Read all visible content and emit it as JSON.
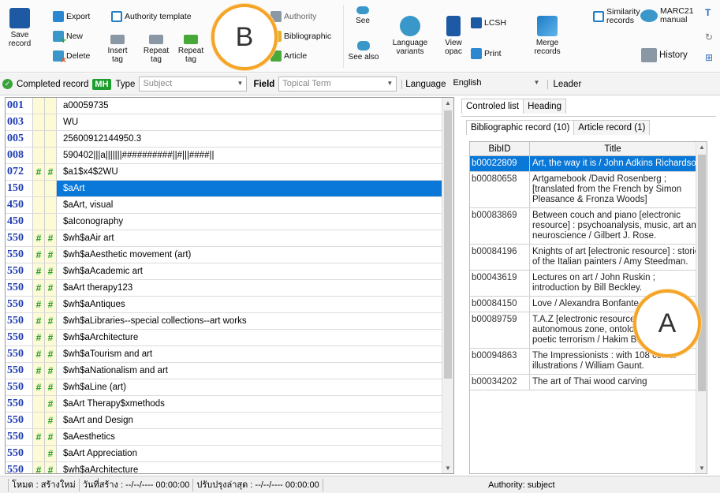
{
  "toolbar": {
    "save": {
      "line1": "Save",
      "line2": "record"
    },
    "export": "Export",
    "new": "New",
    "delete": "Delete",
    "authority_template": "Authority template",
    "insert_tag": {
      "line1": "Insert",
      "line2": "tag"
    },
    "repeat_tag1": {
      "line1": "Repeat",
      "line2": "tag"
    },
    "repeat_tag2": {
      "line1": "Repeat",
      "line2": "tag"
    },
    "authority": "Authority",
    "bibliographic": "Bibliographic",
    "article": "Article",
    "see": "See",
    "see_also": "See also",
    "language_variants": {
      "line1": "Language",
      "line2": "variants"
    },
    "view_opac": {
      "line1": "View",
      "line2": "opac"
    },
    "lcsh": "LCSH",
    "print": "Print",
    "merge_records": {
      "line1": "Merge",
      "line2": "records"
    },
    "similarity_records": {
      "line1": "Similarity",
      "line2": "records"
    },
    "marc21_manual": {
      "line1": "MARC21",
      "line2": "manual"
    },
    "history": "History"
  },
  "callouts": {
    "a": "A",
    "b": "B"
  },
  "status_bar": {
    "completed_record": "Completed record",
    "mh_badge": "MH",
    "type_label": "Type",
    "type_value": "Subject",
    "field_label": "Field",
    "field_value": "Topical Term",
    "language_label": "Language",
    "language_value": "English",
    "leader_label": "Leader"
  },
  "marc_rows": [
    {
      "tag": "001",
      "ind1": "",
      "ind2": "",
      "data": "a00059735"
    },
    {
      "tag": "003",
      "ind1": "",
      "ind2": "",
      "data": "WU"
    },
    {
      "tag": "005",
      "ind1": "",
      "ind2": "",
      "data": "25600912144950.3"
    },
    {
      "tag": "008",
      "ind1": "",
      "ind2": "",
      "data": "590402|||a|||||||##########||#|||####||"
    },
    {
      "tag": "072",
      "ind1": "#",
      "ind2": "#",
      "data": "$a1$x4$2WU"
    },
    {
      "tag": "150",
      "ind1": "",
      "ind2": "",
      "data": "$aArt",
      "selected": true
    },
    {
      "tag": "450",
      "ind1": "",
      "ind2": "",
      "data": "$aArt, visual"
    },
    {
      "tag": "450",
      "ind1": "",
      "ind2": "",
      "data": "$aIconography"
    },
    {
      "tag": "550",
      "ind1": "#",
      "ind2": "#",
      "data": "$wh$aAir art"
    },
    {
      "tag": "550",
      "ind1": "#",
      "ind2": "#",
      "data": "$wh$aAesthetic movement (art)"
    },
    {
      "tag": "550",
      "ind1": "#",
      "ind2": "#",
      "data": "$wh$aAcademic art"
    },
    {
      "tag": "550",
      "ind1": "#",
      "ind2": "#",
      "data": "$aArt therapy123"
    },
    {
      "tag": "550",
      "ind1": "#",
      "ind2": "#",
      "data": "$wh$aAntiques"
    },
    {
      "tag": "550",
      "ind1": "#",
      "ind2": "#",
      "data": "$wh$aLibraries--special collections--art works"
    },
    {
      "tag": "550",
      "ind1": "#",
      "ind2": "#",
      "data": "$wh$aArchitecture"
    },
    {
      "tag": "550",
      "ind1": "#",
      "ind2": "#",
      "data": "$wh$aTourism and art"
    },
    {
      "tag": "550",
      "ind1": "#",
      "ind2": "#",
      "data": "$wh$aNationalism and art"
    },
    {
      "tag": "550",
      "ind1": "#",
      "ind2": "#",
      "data": "$wh$aLine (art)"
    },
    {
      "tag": "550",
      "ind1": "",
      "ind2": "#",
      "data": "$aArt Therapy$xmethods"
    },
    {
      "tag": "550",
      "ind1": "",
      "ind2": "#",
      "data": "$aArt and Design"
    },
    {
      "tag": "550",
      "ind1": "#",
      "ind2": "#",
      "data": "$aAesthetics"
    },
    {
      "tag": "550",
      "ind1": "",
      "ind2": "#",
      "data": "$aArt Appreciation"
    },
    {
      "tag": "550",
      "ind1": "#",
      "ind2": "#",
      "data": "$wh$aArchitecture"
    }
  ],
  "right_panel": {
    "tab_controled_list": "Controled list",
    "tab_heading": "Heading",
    "subtab_bibliographic": "Bibliographic record (10)",
    "subtab_article": "Article record (1)",
    "col_bibid": "BibID",
    "col_title": "Title",
    "rows": [
      {
        "id": "b00022809",
        "title": "Art, the way it is / John Adkins Richardson.",
        "selected": true
      },
      {
        "id": "b00080658",
        "title": "Artgamebook /David Rosenberg ; [translated from the French by Simon Pleasance & Fronza Woods]"
      },
      {
        "id": "b00083869",
        "title": "Between couch and piano [electronic resource] : psychoanalysis, music, art and neuroscience / Gilbert J. Rose."
      },
      {
        "id": "b00084196",
        "title": "Knights of art [electronic resource] : stories of the Italian painters / Amy Steedman."
      },
      {
        "id": "b00043619",
        "title": "Lectures on art / John Ruskin ; introduction by Bill Beckley."
      },
      {
        "id": "b00084150",
        "title": "Love / Alexandra Bonfante-Warren."
      },
      {
        "id": "b00089759",
        "title": "T.A.Z [electronic resource] : the temporary autonomous zone, ontological anarchy, poetic terrorism / Hakim Bey."
      },
      {
        "id": "b00094863",
        "title": "The Impressionists : with 108 colour illustrations / William Gaunt."
      },
      {
        "id": "b00034202",
        "title": "The art of Thai wood carving"
      }
    ]
  },
  "bottom_bar": {
    "mode": "โหมด : สร้างใหม่",
    "created": "วันที่สร้าง : --/--/---- 00:00:00",
    "updated": "ปรับปรุงล่าสุด : --/--/---- 00:00:00",
    "authority": "Authority: subject"
  }
}
